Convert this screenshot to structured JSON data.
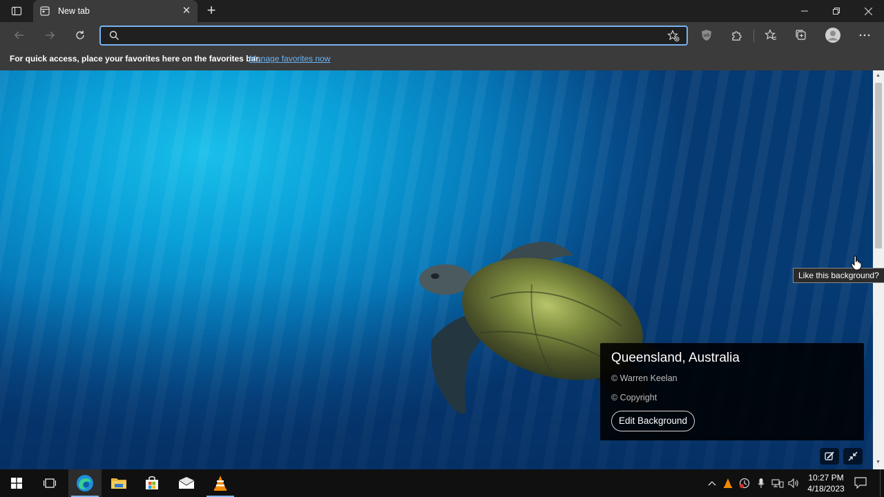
{
  "browser": {
    "tab_title": "New tab",
    "address_value": "",
    "address_placeholder": "",
    "favorites_bar_text": "For quick access, place your favorites here on the favorites bar.",
    "favorites_bar_link": "Manage favorites now",
    "icons": {
      "tab_actions": "tab-actions-icon",
      "favicon": "new-tab-page-icon",
      "close": "close-icon",
      "new_tab": "plus-icon",
      "back": "back-arrow-icon",
      "forward": "forward-arrow-icon",
      "refresh": "refresh-icon",
      "search": "search-icon",
      "add_favorite": "star-add-icon",
      "ublock": "shield-icon",
      "extensions": "puzzle-icon",
      "favorites": "favorites-icon",
      "collections": "collections-icon",
      "profile": "profile-icon",
      "menu": "ellipsis-icon"
    }
  },
  "page": {
    "tooltip": "Like this background?",
    "info_card": {
      "location": "Queensland, Australia",
      "credit": "© Warren Keelan",
      "copyright": "© Copyright",
      "edit_button": "Edit Background"
    }
  },
  "taskbar": {
    "time": "10:27 PM",
    "date": "4/18/2023",
    "tray_overflow": "^"
  },
  "colors": {
    "accent": "#77b4f1",
    "link": "#6cb4f5",
    "toolbar": "#3b3b3b",
    "titlebar": "#1f1f1f",
    "taskbar": "#101010"
  }
}
